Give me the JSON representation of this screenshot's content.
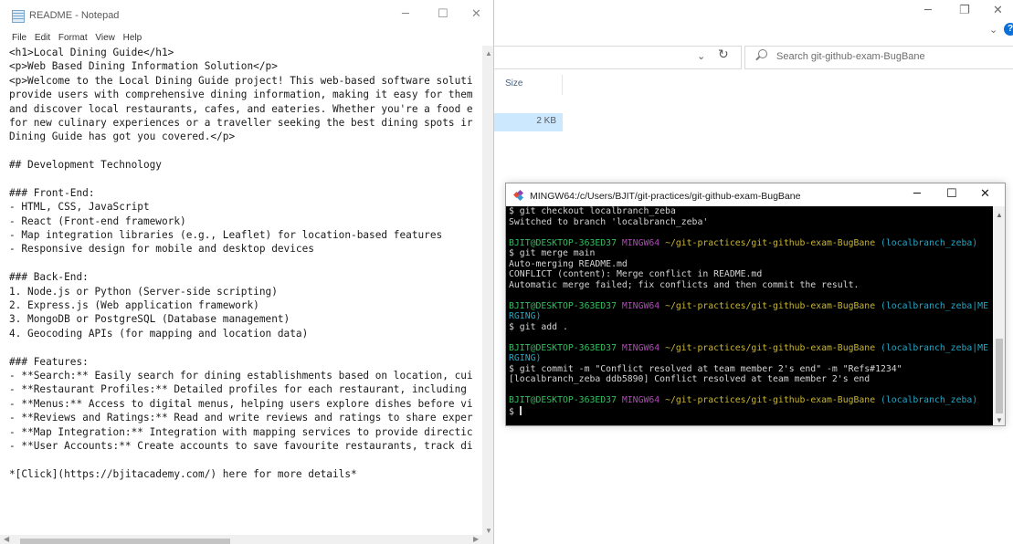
{
  "explorer": {
    "search_placeholder": "Search git-github-exam-BugBane",
    "column_size": "Size",
    "row_size": "2 KB",
    "minimize_symbol": "─",
    "maximize_symbol": "❐",
    "close_symbol": "✕",
    "refresh_symbol": "↻",
    "dropdown_symbol": "⌄"
  },
  "notepad": {
    "title": "README - Notepad",
    "menu": [
      "File",
      "Edit",
      "Format",
      "View",
      "Help"
    ],
    "minimize_symbol": "─",
    "maximize_symbol": "☐",
    "close_symbol": "✕",
    "lines": [
      "<h1>Local Dining Guide</h1>",
      "<p>Web Based Dining Information Solution</p>",
      "<p>Welcome to the Local Dining Guide project! This web-based software soluti",
      "provide users with comprehensive dining information, making it easy for them",
      "and discover local restaurants, cafes, and eateries. Whether you're a food e",
      "for new culinary experiences or a traveller seeking the best dining spots ir",
      "Dining Guide has got you covered.</p>",
      "",
      "## Development Technology",
      "",
      "### Front-End:",
      "- HTML, CSS, JavaScript",
      "- React (Front-end framework)",
      "- Map integration libraries (e.g., Leaflet) for location-based features",
      "- Responsive design for mobile and desktop devices",
      "",
      "### Back-End:",
      "1. Node.js or Python (Server-side scripting)",
      "2. Express.js (Web application framework)",
      "3. MongoDB or PostgreSQL (Database management)",
      "4. Geocoding APIs (for mapping and location data)",
      "",
      "### Features:",
      "- **Search:** Easily search for dining establishments based on location, cui",
      "- **Restaurant Profiles:** Detailed profiles for each restaurant, including",
      "- **Menus:** Access to digital menus, helping users explore dishes before vi",
      "- **Reviews and Ratings:** Read and write reviews and ratings to share exper",
      "- **Map Integration:** Integration with mapping services to provide directic",
      "- **User Accounts:** Create accounts to save favourite restaurants, track di",
      "",
      "*[Click](https://bjitacademy.com/) here for more details*"
    ]
  },
  "terminal": {
    "title": "MINGW64:/c/Users/BJIT/git-practices/git-github-exam-BugBane",
    "minimize_symbol": "─",
    "maximize_symbol": "☐",
    "close_symbol": "✕",
    "colors": {
      "green": "#2fc25b",
      "magenta": "#b248b8",
      "yellow": "#c9b631",
      "cyan": "#21a8c7"
    },
    "lines": [
      [
        {
          "t": "$ git checkout localbranch_zeba",
          "c": "white"
        }
      ],
      [
        {
          "t": "Switched to branch 'localbranch_zeba'",
          "c": "white"
        }
      ],
      [],
      [
        {
          "t": "BJIT@DESKTOP-363ED37 ",
          "c": "green"
        },
        {
          "t": "MINGW64 ",
          "c": "magenta"
        },
        {
          "t": "~/git-practices/git-github-exam-BugBane ",
          "c": "yellow"
        },
        {
          "t": "(localbranch_zeba)",
          "c": "cyan"
        }
      ],
      [
        {
          "t": "$ git merge main",
          "c": "white"
        }
      ],
      [
        {
          "t": "Auto-merging README.md",
          "c": "white"
        }
      ],
      [
        {
          "t": "CONFLICT (content): Merge conflict in README.md",
          "c": "white"
        }
      ],
      [
        {
          "t": "Automatic merge failed; fix conflicts and then commit the result.",
          "c": "white"
        }
      ],
      [],
      [
        {
          "t": "BJIT@DESKTOP-363ED37 ",
          "c": "green"
        },
        {
          "t": "MINGW64 ",
          "c": "magenta"
        },
        {
          "t": "~/git-practices/git-github-exam-BugBane ",
          "c": "yellow"
        },
        {
          "t": "(localbranch_zeba|ME",
          "c": "cyan"
        }
      ],
      [
        {
          "t": "RGING)",
          "c": "cyan"
        }
      ],
      [
        {
          "t": "$ git add .",
          "c": "white"
        }
      ],
      [],
      [
        {
          "t": "BJIT@DESKTOP-363ED37 ",
          "c": "green"
        },
        {
          "t": "MINGW64 ",
          "c": "magenta"
        },
        {
          "t": "~/git-practices/git-github-exam-BugBane ",
          "c": "yellow"
        },
        {
          "t": "(localbranch_zeba|ME",
          "c": "cyan"
        }
      ],
      [
        {
          "t": "RGING)",
          "c": "cyan"
        }
      ],
      [
        {
          "t": "$ git commit -m \"Conflict resolved at team member 2's end\" -m \"Refs#1234\"",
          "c": "white"
        }
      ],
      [
        {
          "t": "[localbranch_zeba ddb5890] Conflict resolved at team member 2's end",
          "c": "white"
        }
      ],
      [],
      [
        {
          "t": "BJIT@DESKTOP-363ED37 ",
          "c": "green"
        },
        {
          "t": "MINGW64 ",
          "c": "magenta"
        },
        {
          "t": "~/git-practices/git-github-exam-BugBane ",
          "c": "yellow"
        },
        {
          "t": "(localbranch_zeba)",
          "c": "cyan"
        }
      ],
      [
        {
          "t": "$ ",
          "c": "white"
        },
        {
          "cursor": true
        }
      ]
    ]
  }
}
